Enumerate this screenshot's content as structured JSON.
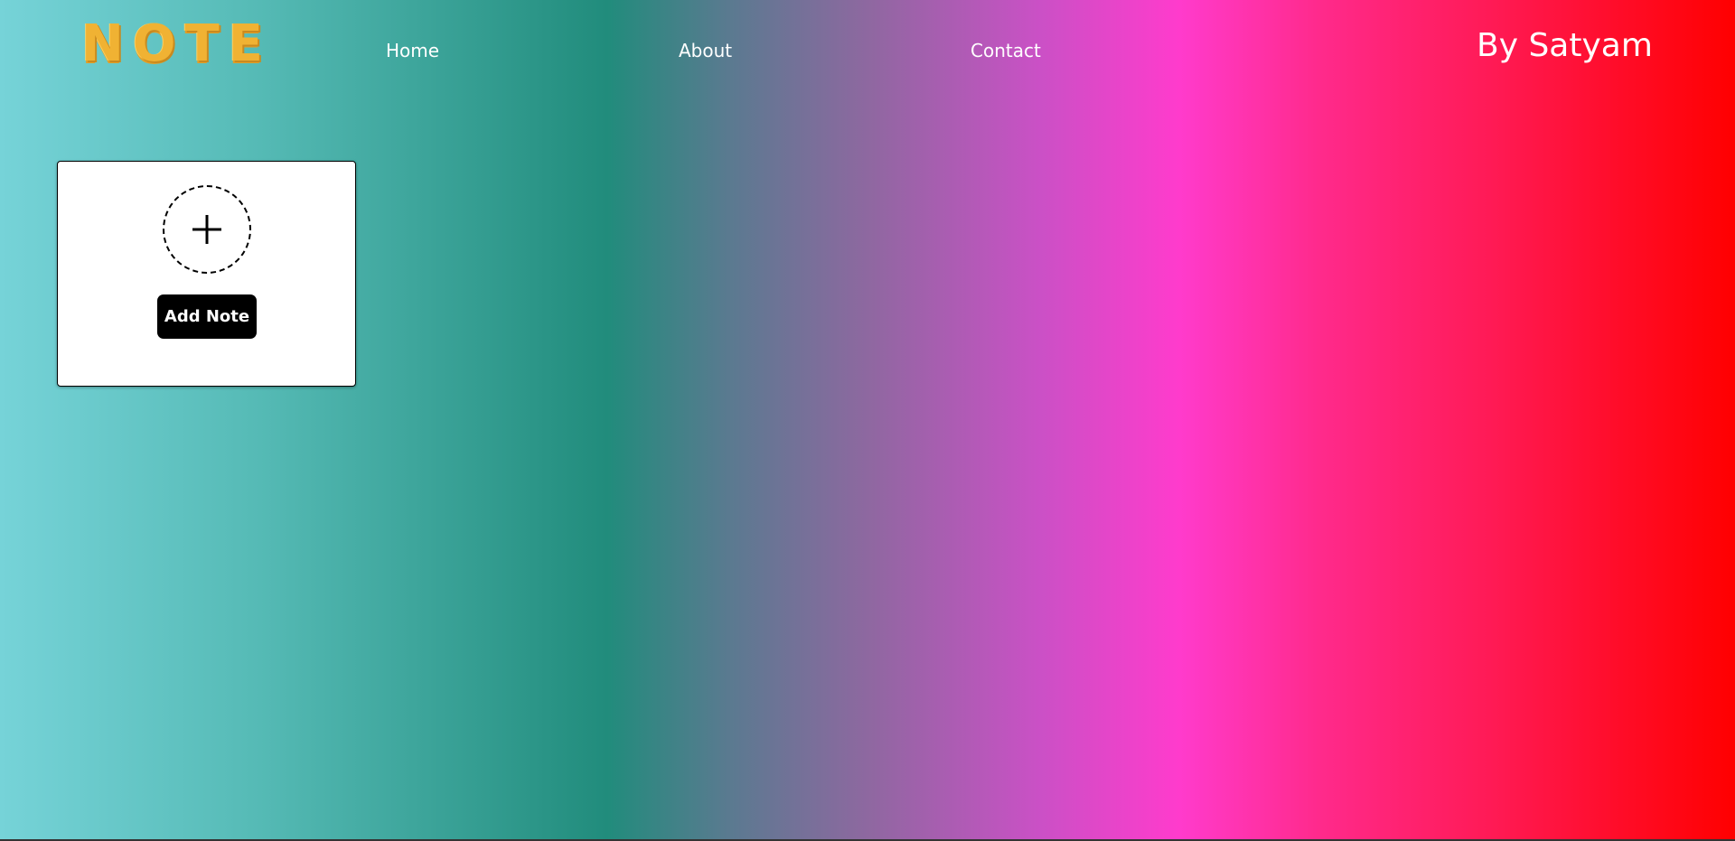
{
  "header": {
    "logo_text": "NOTE",
    "nav": {
      "home": "Home",
      "about": "About",
      "contact": "Contact"
    },
    "author": "By Satyam"
  },
  "note_card": {
    "add_icon": "plus-icon",
    "add_button_label": "Add Note"
  },
  "colors": {
    "gradient": [
      "#76d3d8",
      "#218c7c",
      "#ff3bcc",
      "#ff0000"
    ],
    "logo": "#f0b233",
    "button_bg": "#000000",
    "card_bg": "#ffffff"
  }
}
